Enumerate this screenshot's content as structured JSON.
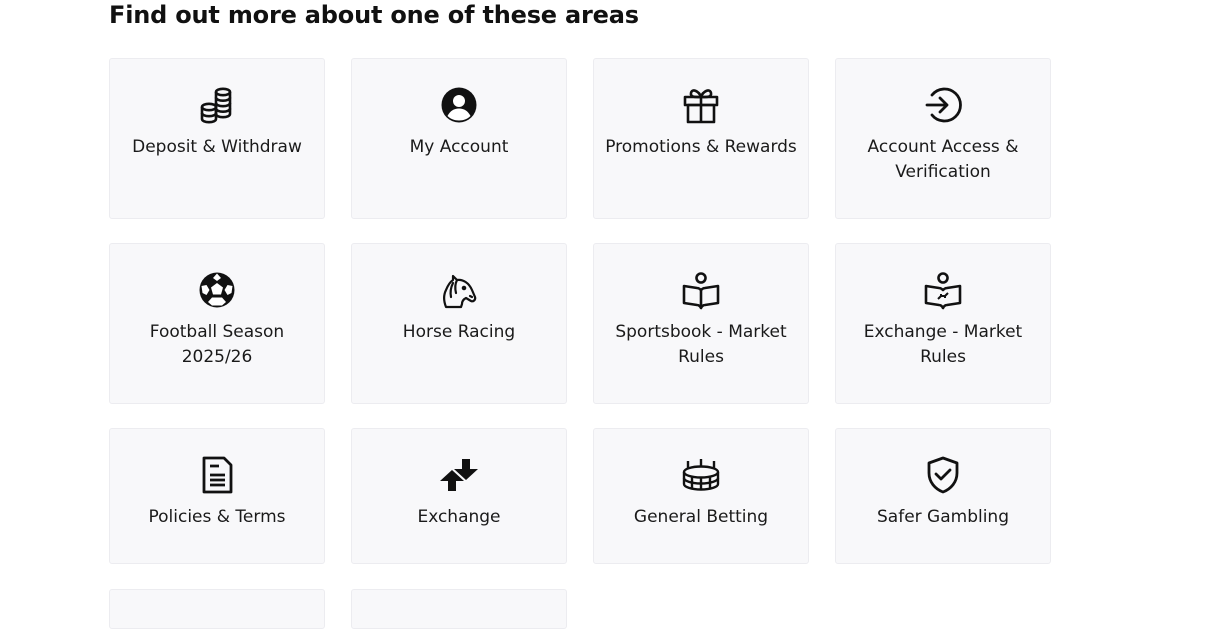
{
  "heading": "Find out more about one of these areas",
  "cards": [
    {
      "label": "Deposit & Withdraw",
      "icon": "coins-icon"
    },
    {
      "label": "My Account",
      "icon": "user-circle-icon"
    },
    {
      "label": "Promotions & Rewards",
      "icon": "gift-icon"
    },
    {
      "label": "Account Access & Verification",
      "icon": "login-arrow-icon"
    },
    {
      "label": "Football Season 2025/26",
      "icon": "football-icon"
    },
    {
      "label": "Horse Racing",
      "icon": "horse-head-icon"
    },
    {
      "label": "Sportsbook - Market Rules",
      "icon": "rulebook-icon"
    },
    {
      "label": "Exchange - Market Rules",
      "icon": "exchange-rulebook-icon"
    },
    {
      "label": "Policies & Terms",
      "icon": "document-icon"
    },
    {
      "label": "Exchange",
      "icon": "exchange-arrows-icon"
    },
    {
      "label": "General Betting",
      "icon": "stadium-icon"
    },
    {
      "label": "Safer Gambling",
      "icon": "shield-check-icon"
    }
  ]
}
